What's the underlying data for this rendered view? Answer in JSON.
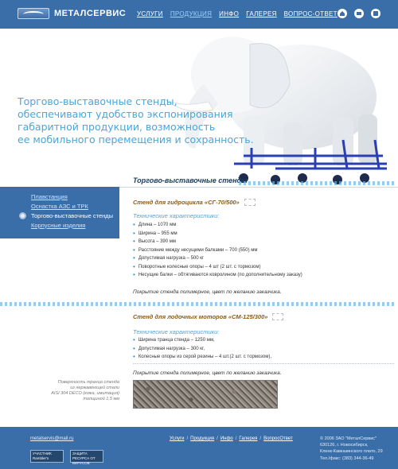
{
  "header": {
    "logo_text": "МЕТАЛСЕРВИС",
    "nav": [
      "УСЛУГИ",
      "ПРОДУКЦИЯ",
      "ИНФО",
      "ГАЛЕРЕЯ",
      "ВОПРОС-ОТВЕТ"
    ],
    "active_nav": "ПРОДУКЦИЯ",
    "icons": [
      "home-icon",
      "mail-icon",
      "sitemap-icon"
    ]
  },
  "hero": {
    "lines": [
      "Торгово-выставочные стенды,",
      "обеспечивают удобство экспонирования",
      "габаритной продукции, возможность",
      "ее мобильного перемещения и сохранность."
    ],
    "image": "elephant-on-stand"
  },
  "sidebar": {
    "items": [
      {
        "label": "Плавстанция",
        "active": false
      },
      {
        "label": "Оснастка АЗС и ТРК",
        "active": false
      },
      {
        "label": "Торгово-выставочные стенды",
        "active": true
      },
      {
        "label": "Корпусные изделия",
        "active": false
      }
    ]
  },
  "main": {
    "title": "Торгово-выставочные стенды",
    "products": [
      {
        "title": "Стенд для гидроцикла «СГ-70/500»",
        "spec_label": "Технические характеристики:",
        "specs": [
          "Длина – 1070 мм",
          "Ширина – 955 мм",
          "Высота – 390 мм",
          "Расстояние между несущими балками – 700 (550) мм",
          "Допустимая нагрузка – 500 кг",
          "Поворотные колесные опоры – 4 шт (2 шт. с тормозом)",
          "Несущие балки – обтягиваются ковролином (по дополнительному заказу)"
        ],
        "note": "Покрытие стенда полимерное, цвет по желанию заказчика."
      },
      {
        "title": "Стенд для лодочных моторов «СМ-125/300»",
        "spec_label": "Технические характеристики:",
        "specs": [
          "Ширина транца стенда – 1250 мм,",
          "Допустимая нагрузка – 300 кг,",
          "Колесные опоры из серой резины – 4 шт.(2 шт. с тормозом),"
        ],
        "note": "Покрытие стенда полимерное, цвет по желанию заказчика."
      }
    ],
    "texture_caption": [
      "Поверхность транца стенда",
      "из нержавеющей стали",
      "AISI 304 DECO (кожа, имитация)",
      "толщиной 1,5 мм"
    ]
  },
  "footer": {
    "email": "metalservis@mail.ru",
    "nav": [
      "Услуги",
      "Продукция",
      "Инфо",
      "Галерея",
      "ВопросОтвет"
    ],
    "info": [
      "© 2006 ЗАО \"МеталСервис\"",
      "630126, г. Новосибирск,",
      "Кленк-Кавказинского плато, 29",
      "Тел./факс: (383) 344-36-49"
    ],
    "badges": [
      {
        "text": "УЧАСТНИК Rambler's"
      },
      {
        "text": "ЗАЩИТА РЕСУРСА ОТ ВИРУСОВ"
      }
    ]
  },
  "colors": {
    "brand_blue": "#3a6ea8",
    "hero_text": "#4aa6d8",
    "product_title": "#8b5a15",
    "spec_label": "#5aa2cc"
  }
}
